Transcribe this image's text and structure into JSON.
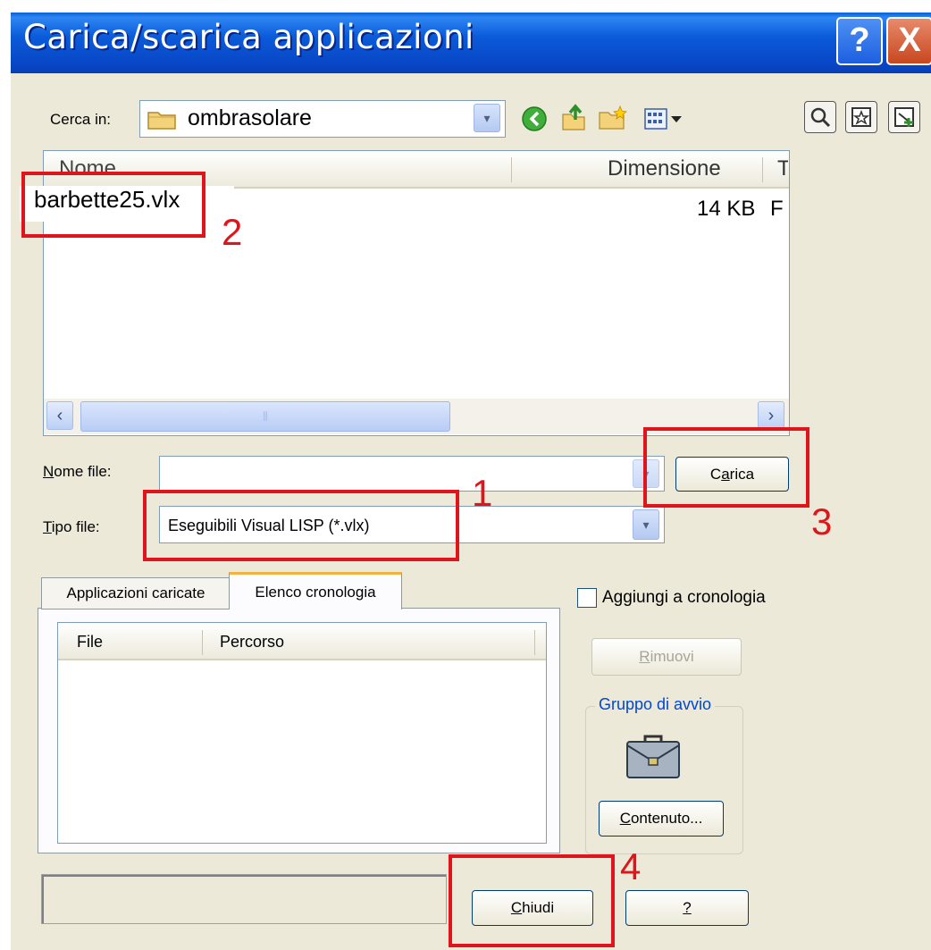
{
  "window": {
    "title": "Carica/scarica applicazioni",
    "help_label": "?",
    "close_label": "X"
  },
  "look_in": {
    "label": "Cerca in:",
    "value": "ombrasolare"
  },
  "file_list": {
    "columns": [
      "Nome",
      "Dimensione",
      "T"
    ],
    "rows": [
      {
        "name": "barbette25.vlx",
        "size": "14 KB",
        "type": "F"
      }
    ]
  },
  "file_name": {
    "label": "Nome file:",
    "value": ""
  },
  "file_type": {
    "label": "Tipo file:",
    "value": "Eseguibili Visual LISP (*.vlx)"
  },
  "buttons": {
    "load": "Carica",
    "close": "Chiudi",
    "help": "?",
    "remove": "Rimuovi",
    "contents": "Contenuto..."
  },
  "tabs": [
    "Applicazioni caricate",
    "Elenco cronologia"
  ],
  "history_list": {
    "columns": [
      "File",
      "Percorso"
    ]
  },
  "add_to_history": {
    "label": "Aggiungi a cronologia",
    "checked": false
  },
  "startup_group": {
    "label": "Gruppo di avvio"
  },
  "annotations": [
    "1",
    "2",
    "3",
    "4"
  ],
  "colors": {
    "titlebar": "#0a52d6",
    "annotation": "#e0141b",
    "dialog": "#ece9d8"
  }
}
